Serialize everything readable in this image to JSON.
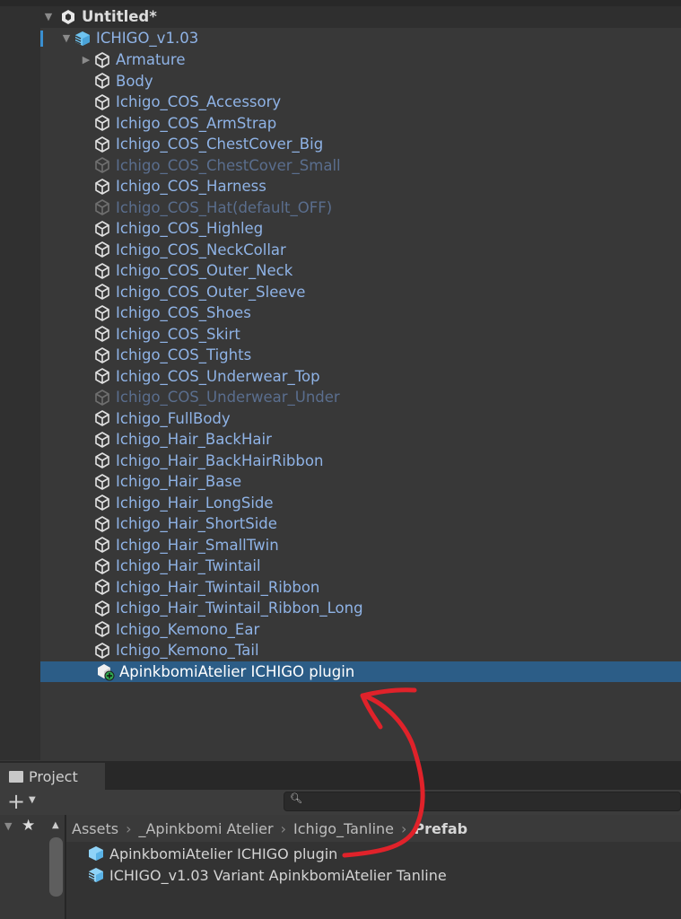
{
  "hierarchy": {
    "scene": "Untitled*",
    "root": "ICHIGO_v1.03",
    "items": [
      {
        "label": "Armature",
        "expandable": true,
        "disabled": false
      },
      {
        "label": "Body",
        "disabled": false
      },
      {
        "label": "Ichigo_COS_Accessory",
        "disabled": false
      },
      {
        "label": "Ichigo_COS_ArmStrap",
        "disabled": false
      },
      {
        "label": "Ichigo_COS_ChestCover_Big",
        "disabled": false
      },
      {
        "label": "Ichigo_COS_ChestCover_Small",
        "disabled": true
      },
      {
        "label": "Ichigo_COS_Harness",
        "disabled": false
      },
      {
        "label": "Ichigo_COS_Hat(default_OFF)",
        "disabled": true
      },
      {
        "label": "Ichigo_COS_Highleg",
        "disabled": false
      },
      {
        "label": "Ichigo_COS_NeckCollar",
        "disabled": false
      },
      {
        "label": "Ichigo_COS_Outer_Neck",
        "disabled": false
      },
      {
        "label": "Ichigo_COS_Outer_Sleeve",
        "disabled": false
      },
      {
        "label": "Ichigo_COS_Shoes",
        "disabled": false
      },
      {
        "label": "Ichigo_COS_Skirt",
        "disabled": false
      },
      {
        "label": "Ichigo_COS_Tights",
        "disabled": false
      },
      {
        "label": "Ichigo_COS_Underwear_Top",
        "disabled": false
      },
      {
        "label": "Ichigo_COS_Underwear_Under",
        "disabled": true
      },
      {
        "label": "Ichigo_FullBody",
        "disabled": false
      },
      {
        "label": "Ichigo_Hair_BackHair",
        "disabled": false
      },
      {
        "label": "Ichigo_Hair_BackHairRibbon",
        "disabled": false
      },
      {
        "label": "Ichigo_Hair_Base",
        "disabled": false
      },
      {
        "label": "Ichigo_Hair_LongSide",
        "disabled": false
      },
      {
        "label": "Ichigo_Hair_ShortSide",
        "disabled": false
      },
      {
        "label": "Ichigo_Hair_SmallTwin",
        "disabled": false
      },
      {
        "label": "Ichigo_Hair_Twintail",
        "disabled": false
      },
      {
        "label": "Ichigo_Hair_Twintail_Ribbon",
        "disabled": false
      },
      {
        "label": "Ichigo_Hair_Twintail_Ribbon_Long",
        "disabled": false
      },
      {
        "label": "Ichigo_Kemono_Ear",
        "disabled": false
      },
      {
        "label": "Ichigo_Kemono_Tail",
        "disabled": false
      }
    ],
    "selected": "ApinkbomiAtelier ICHIGO plugin"
  },
  "project": {
    "tab": "Project",
    "breadcrumb": [
      "Assets",
      "_Apinkbomi Atelier",
      "Ichigo_Tanline"
    ],
    "breadcrumb_current": "Prefab",
    "files": [
      "ApinkbomiAtelier ICHIGO plugin",
      "ICHIGO_v1.03 Variant ApinkbomiAtelier Tanline"
    ]
  },
  "colors": {
    "selection": "#2c5d87",
    "prefab_text": "#8fb3e6",
    "annotation": "#e0222a"
  }
}
